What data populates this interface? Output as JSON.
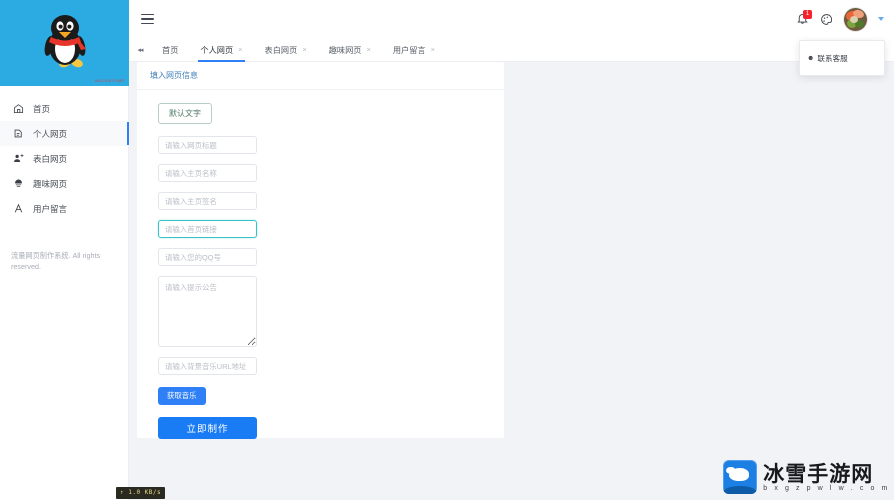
{
  "sidebar": {
    "logo": {
      "icon": "qq-penguin-logo",
      "watermark": "HELLO/HTY.NET"
    },
    "items": [
      {
        "label": "首页",
        "icon": "home-icon",
        "active": false
      },
      {
        "label": "个人网页",
        "icon": "person-page-icon",
        "active": true
      },
      {
        "label": "表白网页",
        "icon": "confession-page-icon",
        "active": false
      },
      {
        "label": "趣味网页",
        "icon": "fun-page-icon",
        "active": false
      },
      {
        "label": "用户留言",
        "icon": "user-message-icon",
        "active": false
      }
    ],
    "footer": "流量网页制作系统. All rights reserved."
  },
  "topbar": {
    "menu_icon": "hamburger-icon",
    "bell_icon": "bell-icon",
    "bell_badge": "1",
    "palette_icon": "palette-icon",
    "avatar_icon": "user-avatar",
    "caret_icon": "caret-down-icon"
  },
  "dropdown": {
    "items": [
      {
        "label": "联系客服",
        "icon": "headset-icon"
      }
    ]
  },
  "tabs": {
    "nav_icon": "tabs-prev-icon",
    "items": [
      {
        "label": "首页",
        "closable": false,
        "active": false
      },
      {
        "label": "个人网页",
        "closable": true,
        "active": true
      },
      {
        "label": "表白网页",
        "closable": true,
        "active": false
      },
      {
        "label": "趣味网页",
        "closable": true,
        "active": false
      },
      {
        "label": "用户留言",
        "closable": true,
        "active": false
      }
    ],
    "close_glyph": "×"
  },
  "card": {
    "title": "填入网页信息",
    "default_text_button": "默认文字",
    "fields": [
      {
        "name": "page-title",
        "placeholder": "请输入网页标题",
        "value": "",
        "focused": false
      },
      {
        "name": "home-name",
        "placeholder": "请输入主页名称",
        "value": "",
        "focused": false
      },
      {
        "name": "home-signature",
        "placeholder": "请输入主页签名",
        "value": "",
        "focused": false
      },
      {
        "name": "home-link",
        "placeholder": "请输入首页链接",
        "value": "",
        "focused": true
      },
      {
        "name": "qq-number",
        "placeholder": "请输入您的QQ号",
        "value": "",
        "focused": false
      }
    ],
    "announcement": {
      "placeholder": "请输入提示公告",
      "value": ""
    },
    "music_url": {
      "placeholder": "请输入背景音乐URL地址",
      "value": ""
    },
    "get_music_button": "获取音乐",
    "submit_button": "立即制作"
  },
  "status": {
    "net_speed": "↑ 1.0 KB/s"
  },
  "watermark": {
    "title": "冰雪手游网",
    "subtitle": "b x g z p w l w . c o m",
    "icon": "polar-bear-logo"
  },
  "colors": {
    "brand_blue": "#2cabe3",
    "accent_blue": "#1a7cf5",
    "tab_active": "#2f80f7",
    "focus_teal": "#39c4c4",
    "badge_red": "#f5222d",
    "content_bg": "#f2f3f7"
  }
}
